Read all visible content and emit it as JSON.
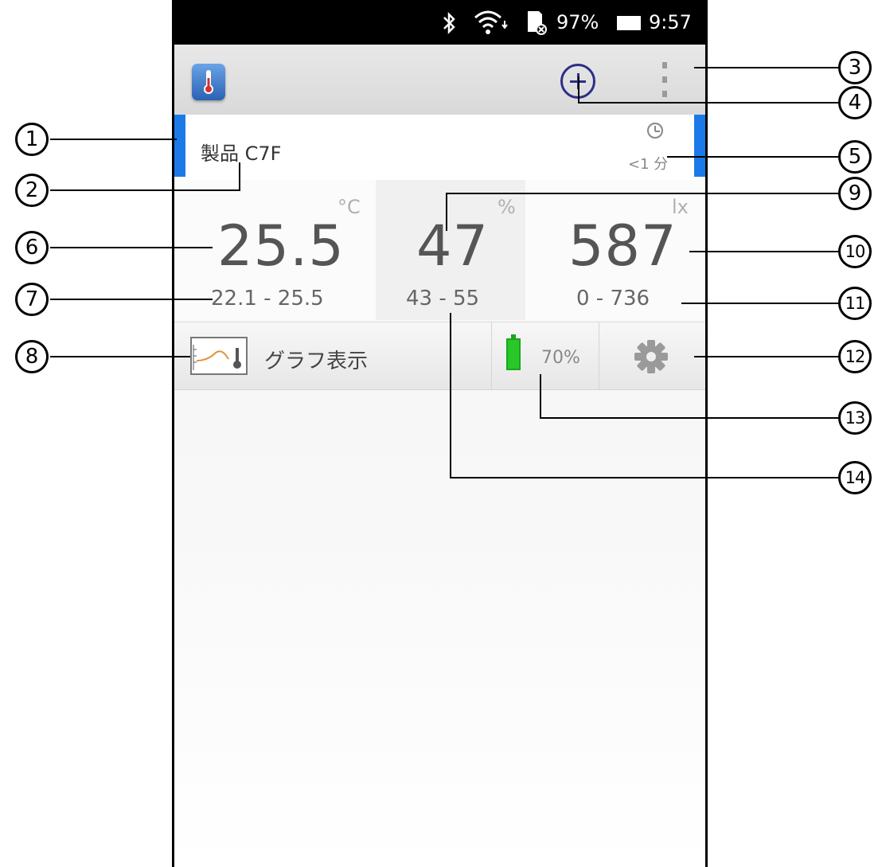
{
  "status_bar": {
    "battery": "97%",
    "time": "9:57"
  },
  "device": {
    "name": "製品 C7F",
    "last_update": "<1 分"
  },
  "readings": [
    {
      "unit": "°C",
      "value": "25.5",
      "range": "22.1 - 25.5"
    },
    {
      "unit": "%",
      "value": "47",
      "range": "43 - 55"
    },
    {
      "unit": "lx",
      "value": "587",
      "range": "0 - 736"
    }
  ],
  "actions": {
    "graph_label": "グラフ表示",
    "battery": "70%"
  },
  "callouts": [
    "1",
    "2",
    "3",
    "4",
    "5",
    "6",
    "7",
    "8",
    "9",
    "10",
    "11",
    "12",
    "13",
    "14"
  ],
  "colors": {
    "accent": "#1c7ae8",
    "battery_green": "#29c729",
    "add_button": "#2d2e86"
  },
  "icons": [
    "bluetooth-icon",
    "wifi-icon",
    "sd-card-icon",
    "battery-icon",
    "thermometer-app-icon",
    "add-icon",
    "overflow-menu-icon",
    "clock-icon",
    "graph-icon",
    "battery-level-icon",
    "gear-icon"
  ]
}
